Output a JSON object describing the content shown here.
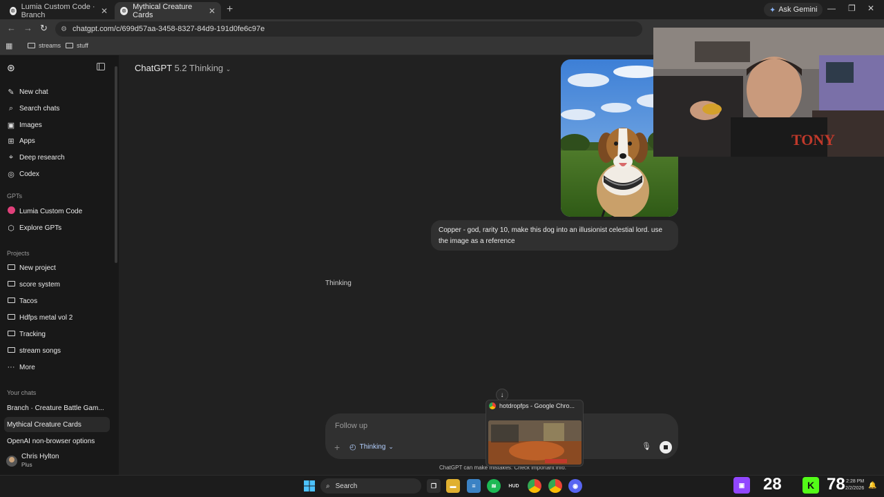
{
  "browser": {
    "tabs": [
      {
        "title": "Lumia Custom Code · Branch",
        "active": false
      },
      {
        "title": "Mythical Creature Cards",
        "active": true
      }
    ],
    "ask_gemini": "Ask Gemini",
    "url": "chatgpt.com/c/699d57aa-3458-8327-84d9-191d0fe6c97e",
    "bookmarks": [
      "streams",
      "stuff"
    ]
  },
  "sidebar": {
    "top_items": [
      {
        "label": "New chat",
        "icon": "edit-icon"
      },
      {
        "label": "Search chats",
        "icon": "search-icon"
      },
      {
        "label": "Images",
        "icon": "image-icon"
      },
      {
        "label": "Apps",
        "icon": "apps-icon"
      },
      {
        "label": "Deep research",
        "icon": "research-icon"
      },
      {
        "label": "Codex",
        "icon": "codex-icon"
      }
    ],
    "gpts_header": "GPTs",
    "gpts": [
      {
        "label": "Lumia Custom Code",
        "icon": "lumia-gpt-icon"
      },
      {
        "label": "Explore GPTs",
        "icon": "explore-icon"
      }
    ],
    "projects_header": "Projects",
    "projects": [
      {
        "label": "New project"
      },
      {
        "label": "score system"
      },
      {
        "label": "Tacos"
      },
      {
        "label": "Hdfps metal vol 2"
      },
      {
        "label": "Tracking"
      },
      {
        "label": "stream songs"
      },
      {
        "label": "More"
      }
    ],
    "chats_header": "Your chats",
    "chats": [
      {
        "label": "Branch · Creature Battle Gam...",
        "selected": false
      },
      {
        "label": "Mythical Creature Cards",
        "selected": true
      },
      {
        "label": "OpenAI non-browser options",
        "selected": false
      }
    ],
    "user": {
      "name": "Chris Hylton",
      "plan": "Plus"
    }
  },
  "main": {
    "model_name": "ChatGPT",
    "model_version": "5.2 Thinking",
    "user_message": "Copper - god, rarity 10, make this dog into an illusionist celestial lord. use the image as a reference",
    "status": "Thinking",
    "composer_placeholder": "Follow up",
    "thinking_pill": "Thinking",
    "disclaimer": "ChatGPT can make mistakes. Check important info."
  },
  "preview_popup": {
    "title": "hotdropfps - Google Chro..."
  },
  "taskbar": {
    "search_label": "Search",
    "counter_1": "28",
    "counter_2": "78",
    "time": "2:28 PM",
    "date": "2/2/2026"
  }
}
